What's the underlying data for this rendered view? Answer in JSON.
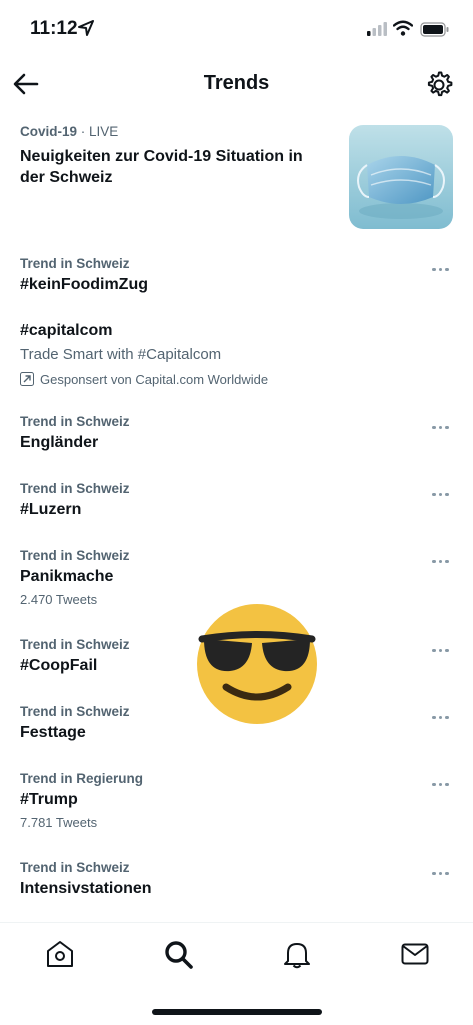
{
  "status": {
    "time": "11:12"
  },
  "header": {
    "title": "Trends"
  },
  "covid": {
    "topic": "Covid-19",
    "separator": " · ",
    "live": "LIVE",
    "headline": "Neuigkeiten zur Covid-19 Situation in der Schweiz"
  },
  "trends": [
    {
      "category": "Trend in Schweiz",
      "name": "#keinFoodimZug",
      "tweets": ""
    },
    {
      "category": "Trend in Schweiz",
      "name": "Engländer",
      "tweets": ""
    },
    {
      "category": "Trend in Schweiz",
      "name": "#Luzern",
      "tweets": ""
    },
    {
      "category": "Trend in Schweiz",
      "name": "Panikmache",
      "tweets": "2.470 Tweets"
    },
    {
      "category": "Trend in Schweiz",
      "name": "#CoopFail",
      "tweets": ""
    },
    {
      "category": "Trend in Schweiz",
      "name": "Festtage",
      "tweets": ""
    },
    {
      "category": "Trend in Regierung",
      "name": "#Trump",
      "tweets": "7.781 Tweets"
    },
    {
      "category": "Trend in Schweiz",
      "name": "Intensivstationen",
      "tweets": ""
    }
  ],
  "promoted": {
    "name": "#capitalcom",
    "text": "Trade Smart with #Capitalcom",
    "sponsor": "Gesponsert von Capital.com Worldwide"
  },
  "icons": {
    "back": "arrow-left-icon",
    "settings": "gear-icon",
    "more": "more-horizontal-icon",
    "promoted": "promoted-arrow-icon",
    "tabs": [
      "home-icon",
      "search-icon",
      "bell-icon",
      "mail-icon"
    ]
  },
  "colors": {
    "text": "#0f1419",
    "secondary": "#536471",
    "emoji": "#f3c242"
  }
}
